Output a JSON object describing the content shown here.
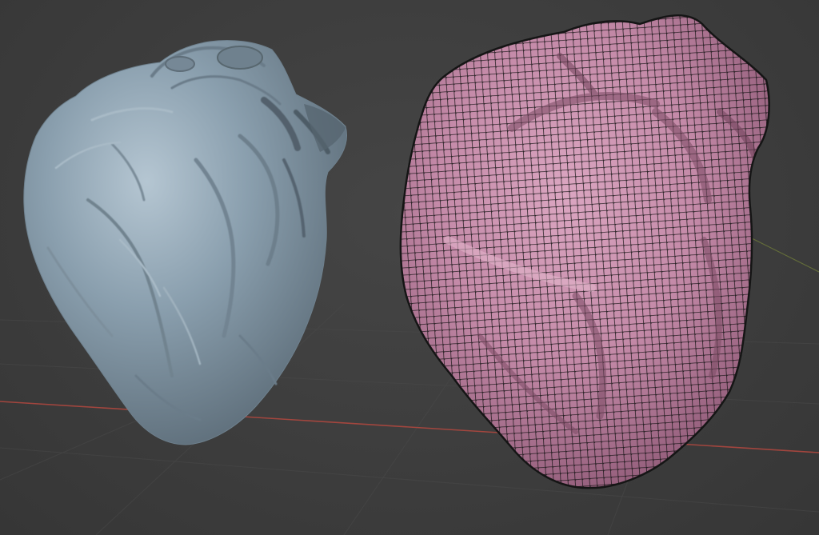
{
  "viewport": {
    "background": "#3c3c3c",
    "grid_color": "#4a4a4a",
    "x_axis_color": "#b5483f",
    "y_axis_color": "#7f8f3a"
  },
  "objects": [
    {
      "id": "sculpt-heart",
      "mode": "solid",
      "color": "#8a9fae",
      "shadow_color": "#5d6d79",
      "highlight_color": "#b5c6d2"
    },
    {
      "id": "wireframe-heart",
      "mode": "wireframe-overlay",
      "color": "#c48aa8",
      "shadow_color": "#8a5572",
      "wire_color": "#111111"
    }
  ]
}
